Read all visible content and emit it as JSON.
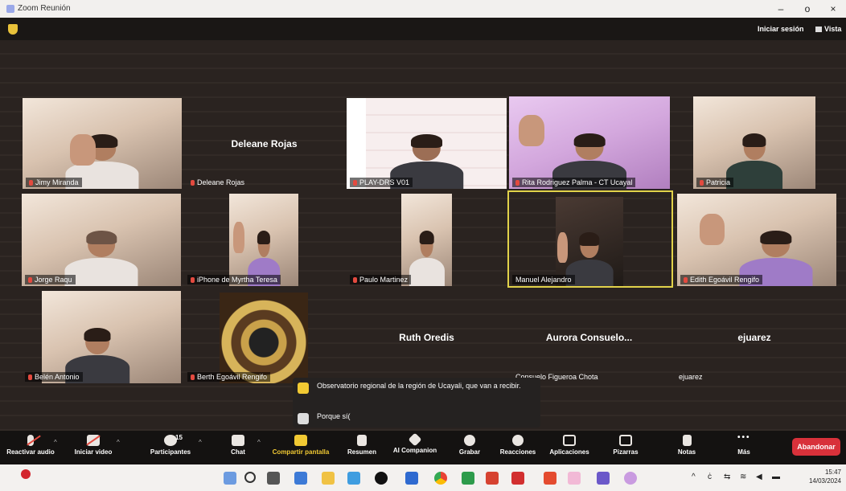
{
  "window": {
    "title": "Zoom Reunión",
    "minimize": "–",
    "maximize": "o",
    "close": "×"
  },
  "top": {
    "sign_in": "Iniciar sesión",
    "view": "Vista"
  },
  "participants": [
    {
      "name": "Jimy Miranda"
    },
    {
      "name": "Deleane Rojas",
      "label": "Deleane Rojas"
    },
    {
      "name": "PLAY-DRS V01"
    },
    {
      "name": "Rita Rodriguez Palma - CT Ucayal"
    },
    {
      "name": "Patricia"
    },
    {
      "name": "Jorge Raqu"
    },
    {
      "name": "iPhone de Myrtha Teresa"
    },
    {
      "name": "Paulo Martinez"
    },
    {
      "name": "Manuel Alejandro"
    },
    {
      "name": "Edith Egoávil Rengifo"
    },
    {
      "name": "Belén Antonio"
    },
    {
      "name": "Berth Egoávil Rengifo"
    },
    {
      "name": "",
      "label": "Ruth Oredis"
    },
    {
      "name": "Consuelo Figueroa Chota",
      "label": "Aurora Consuelo..."
    },
    {
      "name": "ejuarez",
      "label": "ejuarez"
    }
  ],
  "chat_popup": [
    {
      "text": "Observatorio regional de la región de Ucayali, que van a recibir."
    },
    {
      "text": "Porque sí("
    }
  ],
  "toolbar": {
    "audio": "Reactivar audio",
    "video": "Iniciar video",
    "participants": "Participantes",
    "participants_count": "15",
    "chat": "Chat",
    "share": "Compartir pantalla",
    "summary": "Resumen",
    "companion": "AI Companion",
    "record": "Grabar",
    "reactions": "Reacciones",
    "apps": "Aplicaciones",
    "whiteboards": "Pizarras",
    "notes": "Notas",
    "more": "Más",
    "leave": "Abandonar"
  },
  "taskbar": {
    "time": "15:47",
    "date": "14/03/2024"
  },
  "colors": {
    "accent": "#f1c933",
    "leave": "#d8313a",
    "speaker_highlight": "#e1d24a",
    "muted": "#e34a3f"
  }
}
